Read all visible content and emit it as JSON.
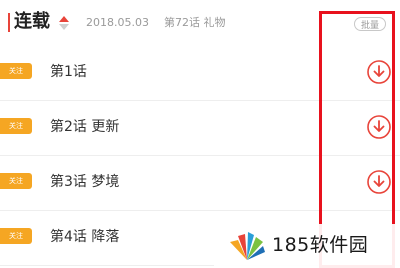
{
  "header": {
    "title": "连载",
    "date": "2018.05.03",
    "latest_chapter": "第72话 礼物",
    "batch_label": "批量"
  },
  "chapters": [
    {
      "badge": "关注",
      "label": "第1话"
    },
    {
      "badge": "关注",
      "label": "第2话 更新"
    },
    {
      "badge": "关注",
      "label": "第3话 梦境"
    },
    {
      "badge": "关注",
      "label": "第4话 降落"
    }
  ],
  "watermark": {
    "text": "185软件园"
  },
  "colors": {
    "accent": "#e8443a",
    "badge": "#f5a623",
    "highlight": "#e8111d"
  },
  "icons": {
    "sort": "sort-triangles-icon",
    "download": "download-circle-icon"
  }
}
